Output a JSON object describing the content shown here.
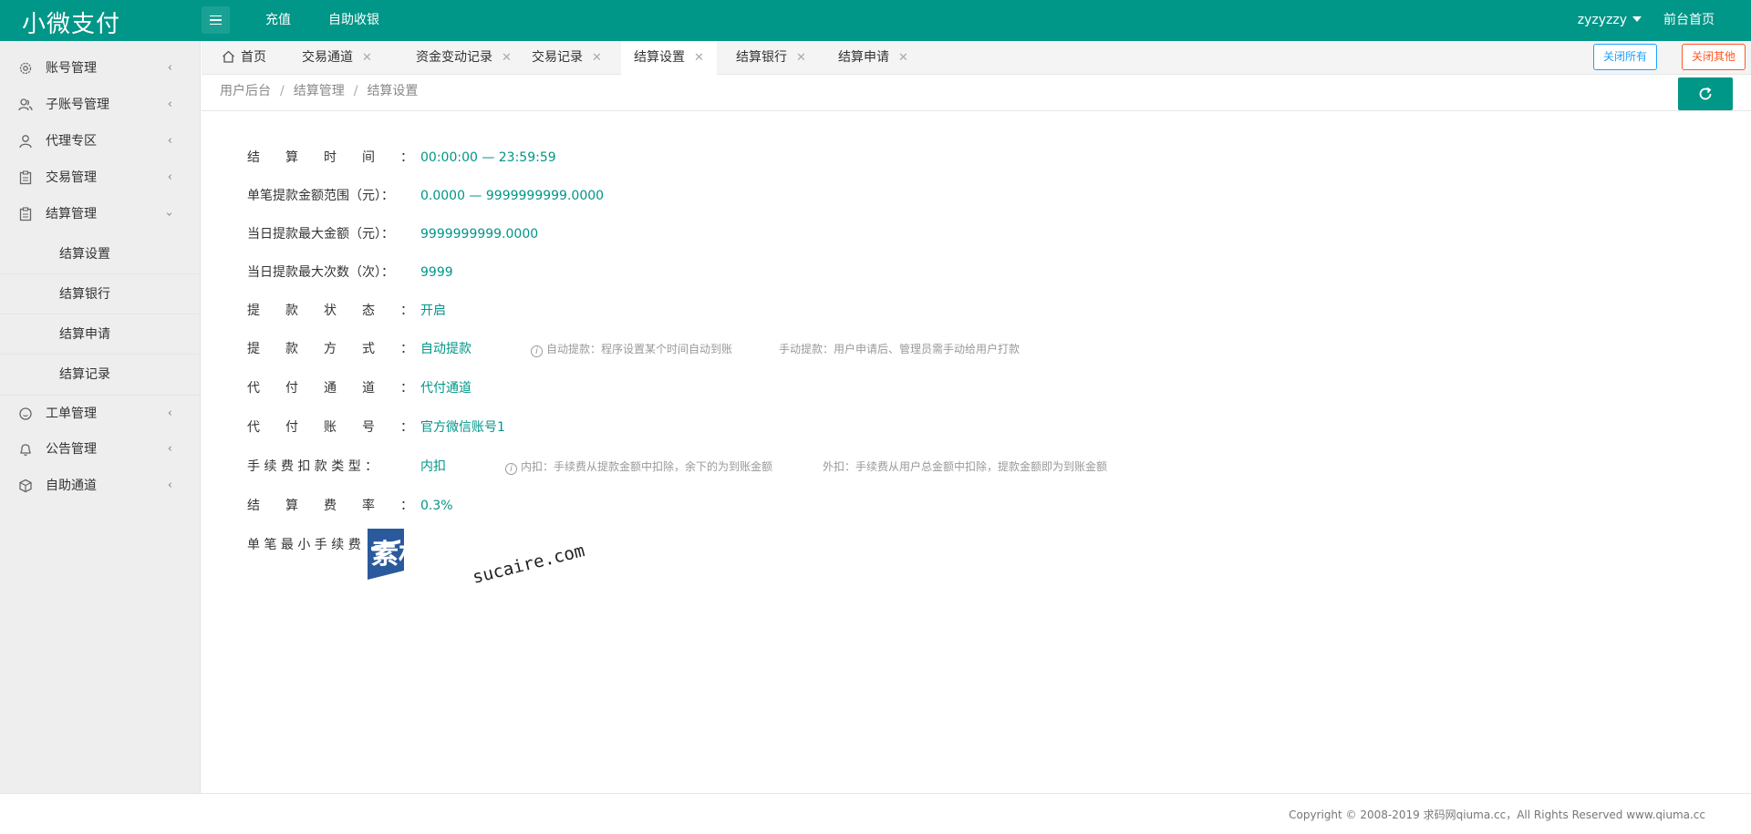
{
  "header": {
    "logo": "小微支付",
    "nav": [
      "充值",
      "自助收银"
    ],
    "user": "zyzyzzy",
    "front_link": "前台首页"
  },
  "sidebar": {
    "items": [
      {
        "label": "账号管理",
        "icon": "gear-icon"
      },
      {
        "label": "子账号管理",
        "icon": "users-icon"
      },
      {
        "label": "代理专区",
        "icon": "user-icon"
      },
      {
        "label": "交易管理",
        "icon": "clipboard-icon"
      },
      {
        "label": "结算管理",
        "icon": "clipboard-icon"
      },
      {
        "label": "工单管理",
        "icon": "chat-icon"
      },
      {
        "label": "公告管理",
        "icon": "bell-icon"
      },
      {
        "label": "自助通道",
        "icon": "box-icon"
      }
    ],
    "sub_items": [
      "结算设置",
      "结算银行",
      "结算申请",
      "结算记录"
    ]
  },
  "tabs": {
    "home": "首页",
    "items": [
      "交易通道",
      "资金变动记录",
      "交易记录",
      "结算设置",
      "结算银行",
      "结算申请"
    ],
    "active": "结算设置",
    "close_all": "关闭所有",
    "close_other": "关闭其他"
  },
  "breadcrumb": [
    "用户后台",
    "结算管理",
    "结算设置"
  ],
  "settings": {
    "time_label": "结　　算　　时　　间　　：",
    "time_value": "00:00:00 — 23:59:59",
    "range_label": "单笔提款金额范围（元）：",
    "range_value": "0.0000 — 9999999999.0000",
    "max_amount_label": "当日提款最大金额（元）：",
    "max_amount_value": "9999999999.0000",
    "max_count_label": "当日提款最大次数（次）：",
    "max_count_value": "9999",
    "status_label": "提　　款　　状　　态　　：",
    "status_value": "开启",
    "method_label": "提　　款　　方　　式　　：",
    "method_value": "自动提款",
    "method_hint_auto": "自动提款：程序设置某个时间自动到账",
    "method_hint_manual": "手动提款：用户申请后、管理员需手动给用户打款",
    "channel_label": "代　　付　　通　　道　　：",
    "channel_value": "代付通道",
    "account_label": "代　　付　　账　　号　　：",
    "account_value": "官方微信账号1",
    "fee_type_label": "手 续 费 扣 款 类 型 ：",
    "fee_type_value": "内扣",
    "fee_hint_inner": "内扣：手续费从提款金额中扣除，余下的为到账金额",
    "fee_hint_outer": "外扣：手续费从用户总金额中扣除，提款金额即为到账金额",
    "rate_label": "结　　算　　费　　率　　：",
    "rate_value": "0.3%",
    "min_fee_label": "单 笔 最 小 手 续 费"
  },
  "watermark": {
    "cn": "素材熱",
    "en": "sucaire.com"
  },
  "footer": {
    "copyright": "Copyright © 2008-2019 求码网qiuma.cc，All Rights Reserved www.qiuma.cc"
  },
  "colors": {
    "primary": "#009688",
    "sidebar_bg": "#eeeeee",
    "close_all": "#1e9fff",
    "close_other": "#ff5722"
  }
}
